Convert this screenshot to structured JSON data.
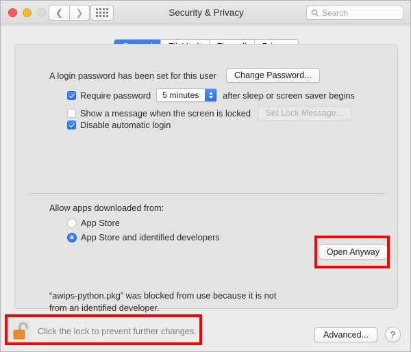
{
  "window": {
    "title": "Security & Privacy",
    "traffic_lights": [
      "close",
      "minimize",
      "zoom"
    ],
    "nav": {
      "back_icon": "chevron-left-icon",
      "forward_icon": "chevron-right-icon"
    },
    "show_all_icon": "grid-dots-icon"
  },
  "search": {
    "placeholder": "Search",
    "value": "",
    "icon": "search-icon"
  },
  "tabs": [
    {
      "label": "General",
      "active": true
    },
    {
      "label": "FileVault",
      "active": false
    },
    {
      "label": "Firewall",
      "active": false
    },
    {
      "label": "Privacy",
      "active": false
    }
  ],
  "general": {
    "login_password_text": "A login password has been set for this user",
    "change_password_label": "Change Password...",
    "require_password": {
      "label": "Require password",
      "checked": true,
      "delay_value": "5 minutes",
      "suffix": "after sleep or screen saver begins"
    },
    "show_message": {
      "label": "Show a message when the screen is locked",
      "checked": false,
      "button_label": "Set Lock Message...",
      "button_disabled": true
    },
    "disable_auto_login": {
      "label": "Disable automatic login",
      "checked": true
    },
    "allow_apps": {
      "heading": "Allow apps downloaded from:",
      "options": [
        {
          "label": "App Store",
          "selected": false
        },
        {
          "label": "App Store and identified developers",
          "selected": true
        }
      ]
    },
    "blocked_message": "“awips-python.pkg” was blocked from use because it is not from an identified developer.",
    "open_anyway_label": "Open Anyway"
  },
  "footer": {
    "lock_icon": "unlocked-padlock-icon",
    "lock_caption": "Click the lock to prevent further changes.",
    "advanced_label": "Advanced...",
    "help_label": "?"
  },
  "annotations": {
    "color": "#ff0000",
    "boxes": [
      "open-anyway-button",
      "lock-row"
    ]
  }
}
